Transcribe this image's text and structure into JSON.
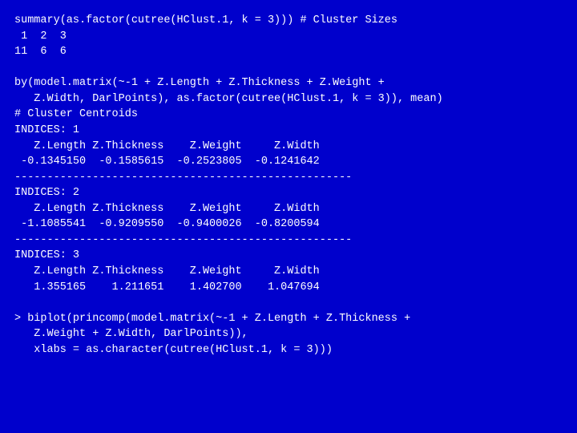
{
  "terminal": {
    "lines": [
      "summary(as.factor(cutree(HClust.1, k = 3))) # Cluster Sizes",
      " 1  2  3",
      "11  6  6",
      "",
      "by(model.matrix(~-1 + Z.Length + Z.Thickness + Z.Weight +",
      "   Z.Width, DarlPoints), as.factor(cutree(HClust.1, k = 3)), mean)",
      "# Cluster Centroids",
      "INDICES: 1",
      "   Z.Length Z.Thickness    Z.Weight     Z.Width",
      " -0.1345150  -0.1585615  -0.2523805  -0.1241642",
      "----------------------------------------------------",
      "INDICES: 2",
      "   Z.Length Z.Thickness    Z.Weight     Z.Width",
      " -1.1085541  -0.9209550  -0.9400026  -0.8200594",
      "----------------------------------------------------",
      "INDICES: 3",
      "   Z.Length Z.Thickness    Z.Weight     Z.Width",
      "   1.355165    1.211651    1.402700    1.047694",
      "",
      "> biplot(princomp(model.matrix(~-1 + Z.Length + Z.Thickness +",
      "   Z.Weight + Z.Width, DarlPoints)),",
      "   xlabs = as.character(cutree(HClust.1, k = 3)))"
    ]
  }
}
